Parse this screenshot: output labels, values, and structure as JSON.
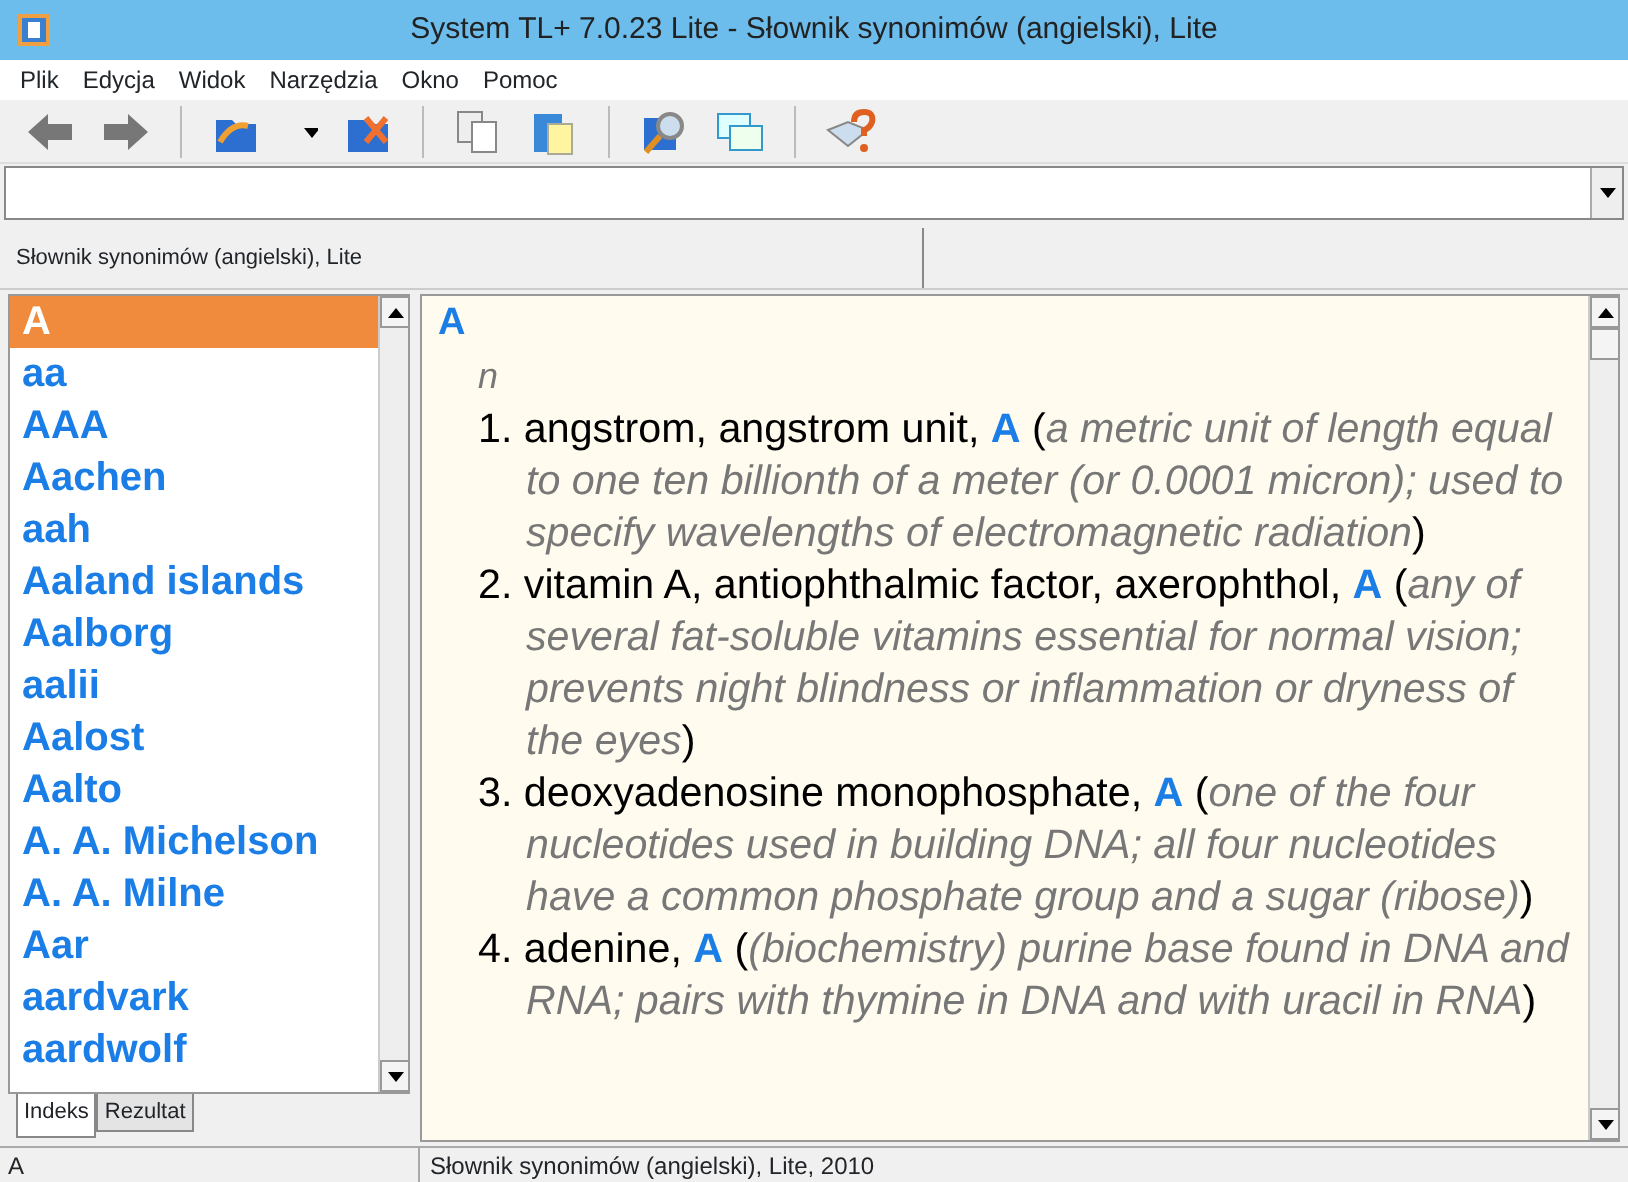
{
  "window": {
    "title": "System TL+ 7.0.23 Lite - Słownik synonimów (angielski), Lite"
  },
  "menu": [
    "Plik",
    "Edycja",
    "Widok",
    "Narzędzia",
    "Okno",
    "Pomoc"
  ],
  "document_tab": {
    "label": "Słownik synonimów (angielski), Lite"
  },
  "word_list": [
    {
      "label": "A",
      "selected": true
    },
    {
      "label": "aa",
      "selected": false
    },
    {
      "label": "AAA",
      "selected": false
    },
    {
      "label": "Aachen",
      "selected": false
    },
    {
      "label": "aah",
      "selected": false
    },
    {
      "label": "Aaland islands",
      "selected": false
    },
    {
      "label": "Aalborg",
      "selected": false
    },
    {
      "label": "aalii",
      "selected": false
    },
    {
      "label": "Aalost",
      "selected": false
    },
    {
      "label": "Aalto",
      "selected": false
    },
    {
      "label": "A. A. Michelson",
      "selected": false
    },
    {
      "label": "A. A. Milne",
      "selected": false
    },
    {
      "label": "Aar",
      "selected": false
    },
    {
      "label": "aardvark",
      "selected": false
    },
    {
      "label": "aardwolf",
      "selected": false
    }
  ],
  "bottom_tabs": [
    {
      "label": "Indeks",
      "selected": true
    },
    {
      "label": "Rezultat",
      "selected": false
    }
  ],
  "entry": {
    "headword": "A",
    "part_of_speech": "n",
    "senses": [
      {
        "number": "1.",
        "synonyms": "angstrom, angstrom unit,",
        "word": "A",
        "open": "(",
        "gloss": "a metric unit of length equal to one ten billionth of a meter (or 0.0001 micron); used to specify wavelengths of electromagnetic radiation",
        "close": ")"
      },
      {
        "number": "2.",
        "synonyms": "vitamin A, antiophthalmic factor, axerophthol,",
        "word": "A",
        "open": "(",
        "gloss": "any of several fat-soluble vitamins essential for normal vision; prevents night blindness or inflammation or dryness of the eyes",
        "close": ")"
      },
      {
        "number": "3.",
        "synonyms": "deoxyadenosine monophosphate,",
        "word": "A",
        "open": "(",
        "gloss": "one of the four nucleotides used in building DNA; all four nucleotides have a common phosphate group and a sugar (ribose)",
        "close": ")"
      },
      {
        "number": "4.",
        "synonyms": "adenine,",
        "word": "A",
        "open": "(",
        "gloss": "(biochemistry) purine base found in DNA and RNA; pairs with thymine in DNA and with uracil in RNA",
        "close": ")"
      }
    ]
  },
  "status_bar": [
    "A",
    "Słownik synonimów (angielski), Lite, 2010"
  ]
}
